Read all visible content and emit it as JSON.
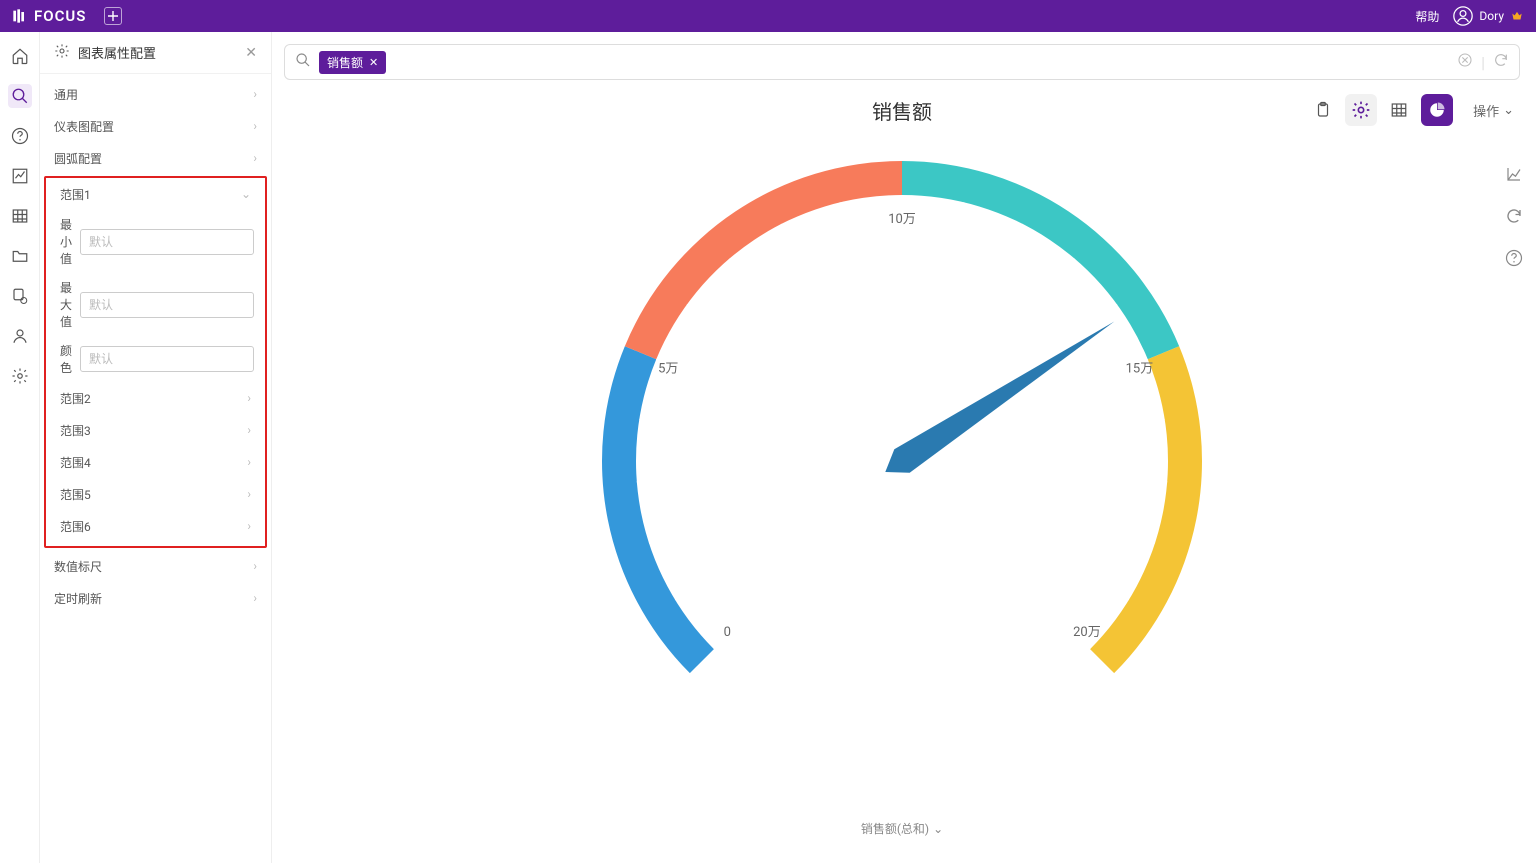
{
  "topbar": {
    "brand": "FOCUS",
    "help": "帮助",
    "user": "Dory"
  },
  "config": {
    "title": "图表属性配置",
    "items_above": [
      "通用",
      "仪表图配置",
      "圆弧配置"
    ],
    "range1": {
      "label": "范围1",
      "min_label": "最小值",
      "max_label": "最大值",
      "color_label": "颜色",
      "placeholder": "默认"
    },
    "ranges_rest": [
      "范围2",
      "范围3",
      "范围4",
      "范围5",
      "范围6"
    ],
    "items_below": [
      "数值标尺",
      "定时刷新"
    ]
  },
  "search": {
    "chip": "销售额"
  },
  "toolbar": {
    "op": "操作"
  },
  "chart": {
    "title": "销售额",
    "legend": "销售额(总和)"
  },
  "chart_data": {
    "type": "gauge",
    "title": "销售额",
    "units": "万",
    "min": 0,
    "max": 20,
    "value": 14.2,
    "ticks": [
      {
        "v": 0,
        "label": "0"
      },
      {
        "v": 5,
        "label": "5万"
      },
      {
        "v": 10,
        "label": "10万"
      },
      {
        "v": 15,
        "label": "15万"
      },
      {
        "v": 20,
        "label": "20万"
      }
    ],
    "segments": [
      {
        "to": 5,
        "color": "#3498db"
      },
      {
        "to": 10,
        "color": "#f77b5b"
      },
      {
        "to": 15,
        "color": "#3cc7c5"
      },
      {
        "to": 20,
        "color": "#f4c435"
      }
    ],
    "start_angle_deg": -225,
    "end_angle_deg": 45
  }
}
